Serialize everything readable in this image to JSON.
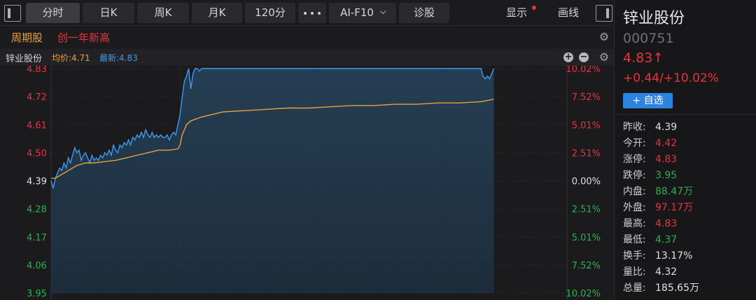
{
  "toolbar": {
    "tabs": [
      "分时",
      "日K",
      "周K",
      "月K",
      "120分"
    ],
    "ai_label": "AI-F10",
    "diagnose_label": "诊股",
    "display_label": "显示",
    "draw_label": "画线"
  },
  "tags": {
    "cycle": "周期股",
    "new_high": "创一年新高"
  },
  "chart_header": {
    "name": "锌业股份",
    "avg": "均价:4.71",
    "last": "最新:4.83"
  },
  "chart_data": {
    "type": "line",
    "ylim": [
      3.95,
      4.83
    ],
    "prev_close": 4.39,
    "price_ticks": [
      {
        "label": "4.83",
        "color": "red"
      },
      {
        "label": "4.72",
        "color": "red"
      },
      {
        "label": "4.61",
        "color": "red"
      },
      {
        "label": "4.50",
        "color": "red"
      },
      {
        "label": "4.39",
        "color": "white"
      },
      {
        "label": "4.28",
        "color": "green"
      },
      {
        "label": "4.17",
        "color": "green"
      },
      {
        "label": "4.06",
        "color": "green"
      },
      {
        "label": "3.95",
        "color": "green"
      }
    ],
    "pct_ticks": [
      {
        "label": "10.02%",
        "color": "red"
      },
      {
        "label": "7.52%",
        "color": "red"
      },
      {
        "label": "5.01%",
        "color": "red"
      },
      {
        "label": "2.51%",
        "color": "red"
      },
      {
        "label": "0.00%",
        "color": "white"
      },
      {
        "label": "2.51%",
        "color": "green"
      },
      {
        "label": "5.01%",
        "color": "green"
      },
      {
        "label": "7.52%",
        "color": "green"
      },
      {
        "label": "10.02%",
        "color": "green"
      }
    ],
    "total_minutes": 240,
    "series": [
      {
        "name": "最新",
        "color": "#3a9bf0",
        "points": [
          [
            0,
            4.39
          ],
          [
            1,
            4.36
          ],
          [
            2,
            4.4
          ],
          [
            3,
            4.42
          ],
          [
            4,
            4.44
          ],
          [
            5,
            4.43
          ],
          [
            6,
            4.46
          ],
          [
            7,
            4.44
          ],
          [
            8,
            4.48
          ],
          [
            9,
            4.46
          ],
          [
            10,
            4.49
          ],
          [
            11,
            4.52
          ],
          [
            12,
            4.5
          ],
          [
            13,
            4.51
          ],
          [
            14,
            4.47
          ],
          [
            15,
            4.49
          ],
          [
            16,
            4.5
          ],
          [
            17,
            4.48
          ],
          [
            18,
            4.46
          ],
          [
            19,
            4.49
          ],
          [
            20,
            4.47
          ],
          [
            21,
            4.48
          ],
          [
            22,
            4.47
          ],
          [
            23,
            4.49
          ],
          [
            24,
            4.48
          ],
          [
            25,
            4.5
          ],
          [
            26,
            4.49
          ],
          [
            27,
            4.51
          ],
          [
            28,
            4.49
          ],
          [
            29,
            4.53
          ],
          [
            30,
            4.51
          ],
          [
            31,
            4.5
          ],
          [
            32,
            4.53
          ],
          [
            33,
            4.52
          ],
          [
            34,
            4.54
          ],
          [
            35,
            4.53
          ],
          [
            36,
            4.55
          ],
          [
            37,
            4.53
          ],
          [
            38,
            4.56
          ],
          [
            39,
            4.55
          ],
          [
            40,
            4.57
          ],
          [
            41,
            4.56
          ],
          [
            42,
            4.58
          ],
          [
            43,
            4.56
          ],
          [
            44,
            4.59
          ],
          [
            45,
            4.57
          ],
          [
            46,
            4.56
          ],
          [
            47,
            4.58
          ],
          [
            48,
            4.56
          ],
          [
            49,
            4.57
          ],
          [
            50,
            4.56
          ],
          [
            51,
            4.57
          ],
          [
            52,
            4.56
          ],
          [
            53,
            4.56
          ],
          [
            54,
            4.57
          ],
          [
            55,
            4.55
          ],
          [
            56,
            4.57
          ],
          [
            57,
            4.58
          ],
          [
            58,
            4.57
          ],
          [
            59,
            4.61
          ],
          [
            60,
            4.65
          ],
          [
            61,
            4.72
          ],
          [
            62,
            4.78
          ],
          [
            63,
            4.8
          ],
          [
            64,
            4.83
          ],
          [
            65,
            4.75
          ],
          [
            66,
            4.81
          ],
          [
            67,
            4.83
          ],
          [
            68,
            4.83
          ],
          [
            69,
            4.82
          ],
          [
            70,
            4.83
          ],
          [
            71,
            4.83
          ],
          [
            72,
            4.83
          ],
          [
            80,
            4.83
          ],
          [
            90,
            4.83
          ],
          [
            100,
            4.83
          ],
          [
            110,
            4.83
          ],
          [
            120,
            4.83
          ],
          [
            130,
            4.83
          ],
          [
            140,
            4.83
          ],
          [
            150,
            4.83
          ],
          [
            160,
            4.83
          ],
          [
            170,
            4.83
          ],
          [
            180,
            4.83
          ],
          [
            190,
            4.83
          ],
          [
            200,
            4.83
          ],
          [
            201,
            4.8
          ],
          [
            202,
            4.79
          ],
          [
            203,
            4.8
          ],
          [
            204,
            4.79
          ],
          [
            205,
            4.81
          ],
          [
            206,
            4.83
          ]
        ]
      },
      {
        "name": "均价",
        "color": "#e6a23c",
        "points": [
          [
            0,
            4.4
          ],
          [
            2,
            4.4
          ],
          [
            4,
            4.41
          ],
          [
            6,
            4.42
          ],
          [
            8,
            4.43
          ],
          [
            10,
            4.44
          ],
          [
            12,
            4.45
          ],
          [
            14,
            4.455
          ],
          [
            16,
            4.46
          ],
          [
            20,
            4.46
          ],
          [
            25,
            4.465
          ],
          [
            30,
            4.47
          ],
          [
            35,
            4.48
          ],
          [
            40,
            4.49
          ],
          [
            45,
            4.5
          ],
          [
            50,
            4.51
          ],
          [
            55,
            4.51
          ],
          [
            59,
            4.515
          ],
          [
            60,
            4.53
          ],
          [
            61,
            4.57
          ],
          [
            62,
            4.59
          ],
          [
            63,
            4.61
          ],
          [
            65,
            4.625
          ],
          [
            70,
            4.64
          ],
          [
            75,
            4.65
          ],
          [
            80,
            4.66
          ],
          [
            90,
            4.665
          ],
          [
            100,
            4.67
          ],
          [
            110,
            4.675
          ],
          [
            120,
            4.675
          ],
          [
            130,
            4.68
          ],
          [
            140,
            4.685
          ],
          [
            150,
            4.685
          ],
          [
            160,
            4.69
          ],
          [
            170,
            4.69
          ],
          [
            180,
            4.695
          ],
          [
            190,
            4.695
          ],
          [
            200,
            4.7
          ],
          [
            206,
            4.71
          ]
        ]
      }
    ]
  },
  "panel": {
    "name": "锌业股份",
    "code": "000751",
    "price": "4.83↑",
    "change": "+0.44/+10.02%",
    "add_label": "+ 自选",
    "stats": [
      {
        "k": "昨收:",
        "v": "4.39",
        "color": "white"
      },
      {
        "k": "今开:",
        "v": "4.42",
        "color": "red"
      },
      {
        "k": "涨停:",
        "v": "4.83",
        "color": "red"
      },
      {
        "k": "跌停:",
        "v": "3.95",
        "color": "green"
      },
      {
        "k": "内盘:",
        "v": "88.47万",
        "color": "green"
      },
      {
        "k": "外盘:",
        "v": "97.17万",
        "color": "red"
      },
      {
        "k": "最高:",
        "v": "4.83",
        "color": "red"
      },
      {
        "k": "最低:",
        "v": "4.37",
        "color": "green"
      },
      {
        "k": "换手:",
        "v": "13.17%",
        "color": "white"
      },
      {
        "k": "量比:",
        "v": "4.32",
        "color": "white"
      },
      {
        "k": "总量:",
        "v": "185.65万",
        "color": "white"
      }
    ]
  }
}
